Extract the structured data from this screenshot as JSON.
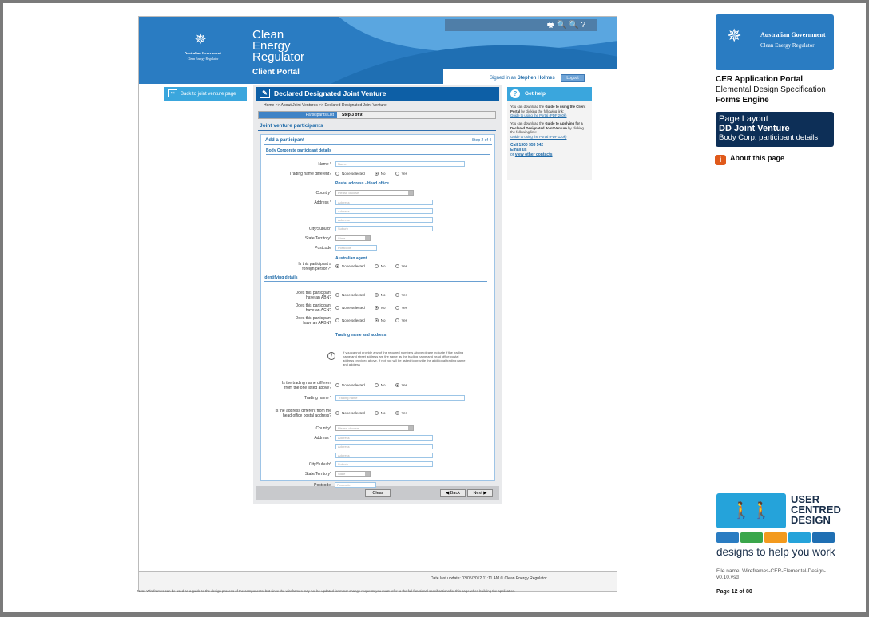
{
  "header": {
    "gov_line1": "Australian Government",
    "gov_line2": "Clean Energy Regulator",
    "title_l1": "Clean",
    "title_l2": "Energy",
    "title_l3": "Regulator",
    "portal": "Client Portal",
    "toolbar_icons": "🖶  🔍 🔍  ?",
    "signed_prefix": "Signed in as",
    "user": "Stephen Holmes",
    "logout": "Logout"
  },
  "back_button": "Back to joint venture page",
  "page_title": "Declared Designated Joint Venture",
  "breadcrumb": "Home >> About Joint Ventures >> Declared Designated Joint Venture",
  "tabs": {
    "list": "Participants List",
    "step": "Step 3 of 9:"
  },
  "section_title": "Joint venture participants",
  "form": {
    "add": "Add a participant",
    "step": "Step 2 of 4",
    "body_corp": "Body Corporate participant details",
    "name_label": "Name *",
    "name_ph": "Name",
    "trading_diff_label": "Trading name different?",
    "radio_none": "None selected",
    "radio_no": "No",
    "radio_yes": "Yes",
    "postal_head": "Postal address - Head office",
    "country_label": "Country*",
    "country_ph": "Please choose",
    "address_label": "Address *",
    "address_ph": "Address",
    "city_label": "City/Suburb*",
    "city_ph": "Suburb",
    "state_label": "State/Territory*",
    "state_ph": "State",
    "postcode_label": "Postcode",
    "postcode_ph": "Postcode",
    "aus_agent": "Australian agent",
    "foreign_l1": "Is this participant a",
    "foreign_l2": "foreign person?*",
    "identifying": "Identifying details",
    "abn_l1": "Does this participant",
    "abn_l2": "have an ABN?",
    "acn_l2": "have an ACN?",
    "arbn_l2": "have an ARBN?",
    "trading_addr": "Trading name and address",
    "info_text": "If you cannot provide any of the required numbers above please indicate if the trading name and street address are the same as the trading name and head office postal address  provided above. If not you will be asked to provide the additional trading name and address",
    "tn_diff_l1": "Is the trading name different",
    "tn_diff_l2": "from the one listed above?",
    "trading_name_label": "Trading name *",
    "trading_name_ph": "Trading name",
    "addr_diff_l1": "Is the address different from the",
    "addr_diff_l2": "head office postal address?",
    "country2_ph": "Please choose",
    "city2_ph": "Suburb",
    "state2_ph": "State",
    "postcode2_ph": "Postcode"
  },
  "buttons": {
    "clear": "Clear",
    "back": "◀  Back",
    "next": "Next  ▶"
  },
  "help": {
    "title": "Get help",
    "p1a": "You can download the",
    "p1b": "Guide to using the Client Portal",
    "p1c": "by clicking the following link:",
    "link1": "Guide to using the Portal (PDF 260k)",
    "p2a": "You can download the",
    "p2b": "Guide to Applying for a Declared Designated Joint Venture",
    "p2c": "by clicking the following link:",
    "link2": "Guide to using the Portal (PDF 120k)",
    "call": "Call 1300 553 542",
    "email": "Email us",
    "or": "or",
    "other": "view other contacts"
  },
  "footer": "Date last update: 03/05/2012 11:11 AM   © Clean Energy Regulator",
  "note": "Note: Wireframes can be used as a guide to the design process of the components, but since the wireframes may not be updated for minor change requests you must refer to the full functional specifications for this page when building the application.",
  "right": {
    "ag1": "Australian Government",
    "ag2": "Clean Energy Regulator",
    "t1": "CER Application Portal",
    "t2": "Elemental Design Specification",
    "t3": "Forms Engine",
    "pl1": "Page Layout",
    "pl2": "DD Joint Venture",
    "pl3": "Body Corp. participant details",
    "about": "About this page",
    "ucd1": "USER",
    "ucd2": "CENTRED",
    "ucd3": "DESIGN",
    "tagline": "designs to help you work",
    "file": "File name: Wireframes-CER-Elemental-Design-v0.10.vsd",
    "page": "Page 12 of 80"
  },
  "colors": {
    "brand_blue": "#2a7cc2",
    "dark_blue": "#0d5fa6",
    "help_blue": "#3aa6dd",
    "navy": "#0d2f57"
  }
}
